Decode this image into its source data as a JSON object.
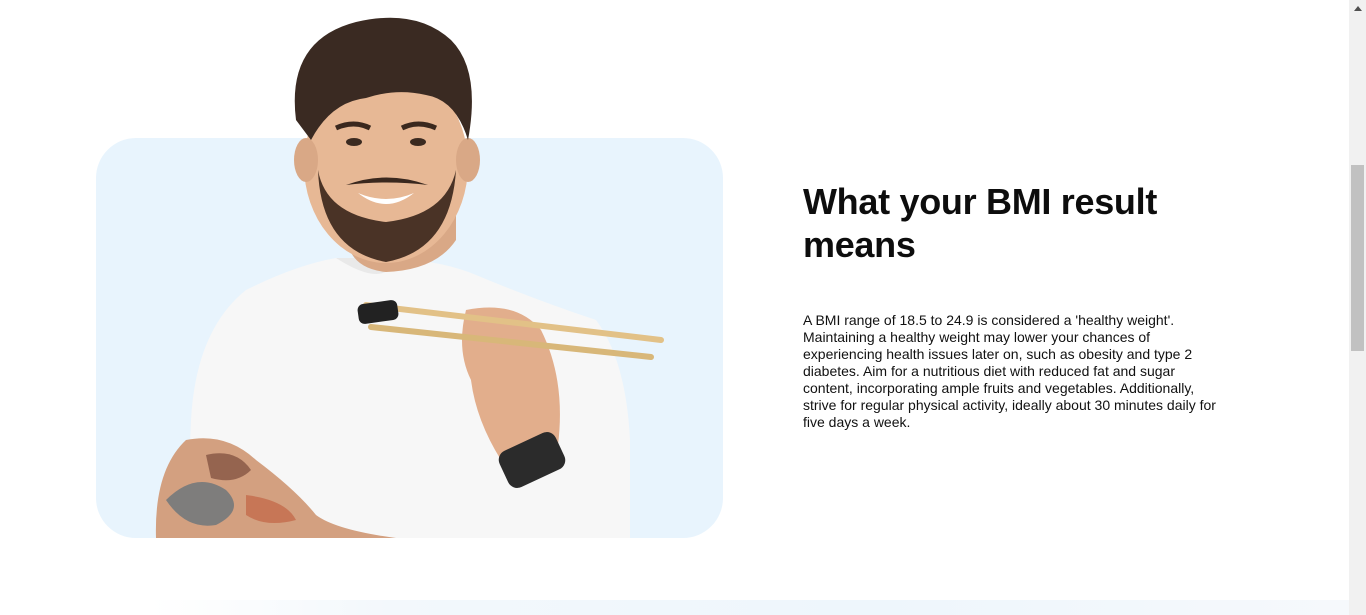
{
  "result_section": {
    "title": "What your BMI result means",
    "body": "A BMI range of 18.5 to 24.9 is considered a 'healthy weight'. Maintaining a healthy weight may lower your chances of experiencing health issues later on, such as obesity and type 2 diabetes. Aim for a nutritious diet with reduced fat and sugar content, incorporating ample fruits and vegetables. Additionally, strive for regular physical activity, ideally about 30 minutes daily for five days a week."
  },
  "colors": {
    "card_background": "#e8f4fd",
    "title_text": "#0d0d0d",
    "body_text": "#111111",
    "scrollbar_track": "#f1f1f1",
    "scrollbar_thumb": "#c1c1c1"
  },
  "icons": {
    "scroll_up": "scroll-up-arrow-icon"
  }
}
